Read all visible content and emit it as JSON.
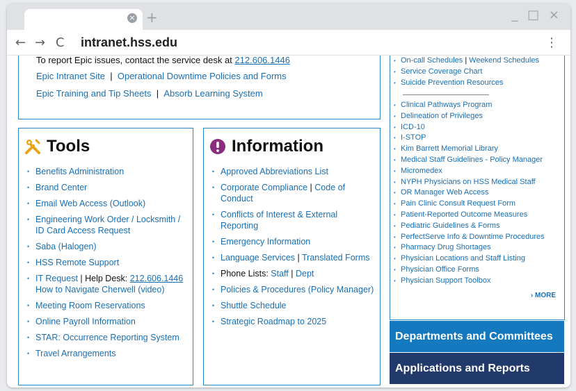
{
  "browser": {
    "tab_close": "×",
    "new_tab": "+",
    "window_controls": "_ □ ×",
    "back": "←",
    "forward": "→",
    "reload": "C",
    "url": "intranet.hss.edu",
    "menu": "⋮"
  },
  "epic": {
    "report_prefix": "To report Epic issues, contact the service desk at ",
    "report_phone": "212.606.1446",
    "row1": [
      "Epic Intranet Site",
      "|",
      "Operational Downtime Policies and Forms"
    ],
    "row2": [
      "Epic Training and Tip Sheets",
      "|",
      "Absorb Learning System"
    ]
  },
  "tools": {
    "title": "Tools",
    "items": [
      {
        "label": "Benefits Administration"
      },
      {
        "label": "Brand Center"
      },
      {
        "label": "Email Web Access (Outlook)"
      },
      {
        "label": "Engineering Work Order / Locksmith / ID Card Access Request"
      },
      {
        "label": "Saba (Halogen)"
      },
      {
        "label": "HSS Remote Support"
      },
      {
        "it_request": "IT Request",
        "sep": " | Help Desk: ",
        "phone": "212.606.1446",
        "cherwell": "How to Navigate Cherwell (video)"
      },
      {
        "label": "Meeting Room Reservations"
      },
      {
        "label": "Online Payroll Information"
      },
      {
        "label": "STAR: Occurrence Reporting System"
      },
      {
        "label": "Travel Arrangements"
      }
    ]
  },
  "information": {
    "title": "Information",
    "items": {
      "abbrev": "Approved Abbreviations List",
      "compliance": "Corporate Compliance",
      "pipe": "|",
      "code": "Code of Conduct",
      "conflicts": "Conflicts of Interest & External Reporting",
      "emergency": "Emergency Information",
      "language": "Language Services",
      "translated": "Translated Forms",
      "phone_prefix": "Phone Lists: ",
      "staff": "Staff",
      "dept": "Dept",
      "policies": "Policies & Procedures (Policy Manager)",
      "shuttle": "Shuttle Schedule",
      "roadmap": "Strategic Roadmap to 2025"
    }
  },
  "right": {
    "oncall": "On-call Schedules",
    "pipe": "|",
    "weekend": "Weekend Schedules",
    "group1": [
      "Service Coverage Chart",
      "Suicide Prevention Resources"
    ],
    "group2": [
      "Clinical Pathways Program",
      "Delineation of Privileges",
      "ICD-10",
      "I-STOP",
      "Kim Barrett Memorial Library",
      "Medical Staff Guidelines - Policy Manager",
      "Micromedex",
      "NYPH Physicians on HSS Medical Staff",
      "OR Manager Web Access",
      "Pain Clinic Consult Request Form",
      "Patient-Reported Outcome Measures",
      "Pediatric Guidelines & Forms",
      "PerfectServe Info & Downtime Procedures",
      "Pharmacy Drug Shortages",
      "Physician Locations and Staff Listing",
      "Physician Office Forms",
      "Physician Support Toolbox"
    ],
    "more": "› MORE"
  },
  "buttons": {
    "departments": "Departments and Committees",
    "applications": "Applications and Reports"
  },
  "colors": {
    "link": "#1a6fb5",
    "border": "#2b86c5",
    "departments_bg": "#1479bf",
    "applications_bg": "#223a6b",
    "tools_icon": "#e8a317",
    "info_icon": "#8a2d7c"
  }
}
